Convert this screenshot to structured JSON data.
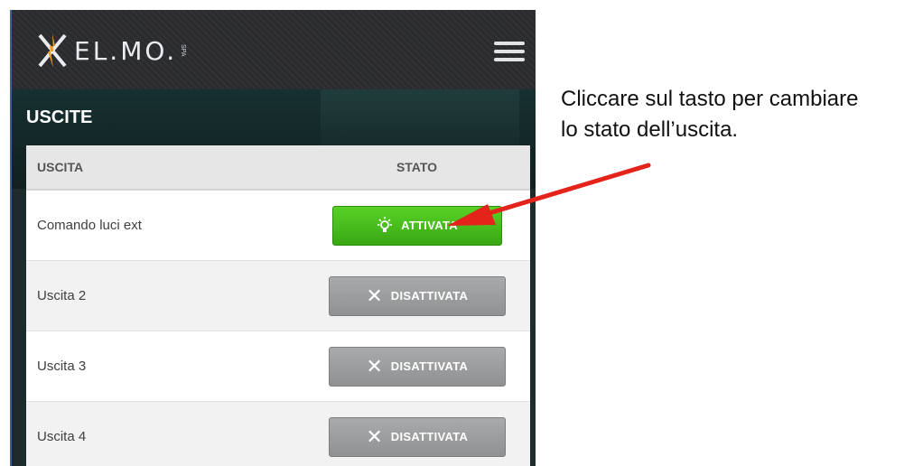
{
  "header": {
    "brand": "EL.MO.",
    "brand_suffix": "SPA"
  },
  "page": {
    "title": "USCITE"
  },
  "table": {
    "headers": {
      "output": "USCITA",
      "state": "STATO"
    },
    "rows": [
      {
        "name": "Comando luci ext",
        "state": "ATTIVATA",
        "active": true
      },
      {
        "name": "Uscita 2",
        "state": "DISATTIVATA",
        "active": false
      },
      {
        "name": "Uscita 3",
        "state": "DISATTIVATA",
        "active": false
      },
      {
        "name": "Uscita 4",
        "state": "DISATTIVATA",
        "active": false
      }
    ]
  },
  "annotation": {
    "text_line1": "Cliccare sul tasto per cambiare",
    "text_line2": "lo stato dell’uscita."
  },
  "icons": {
    "menu": "hamburger-menu-icon",
    "active": "lightbulb-icon",
    "inactive": "close-icon",
    "logo": "elmo-logo-icon"
  },
  "colors": {
    "active": "#4bbf1c",
    "inactive": "#9c9d9e",
    "arrow": "#e4231b",
    "header": "#2a2b2e"
  }
}
